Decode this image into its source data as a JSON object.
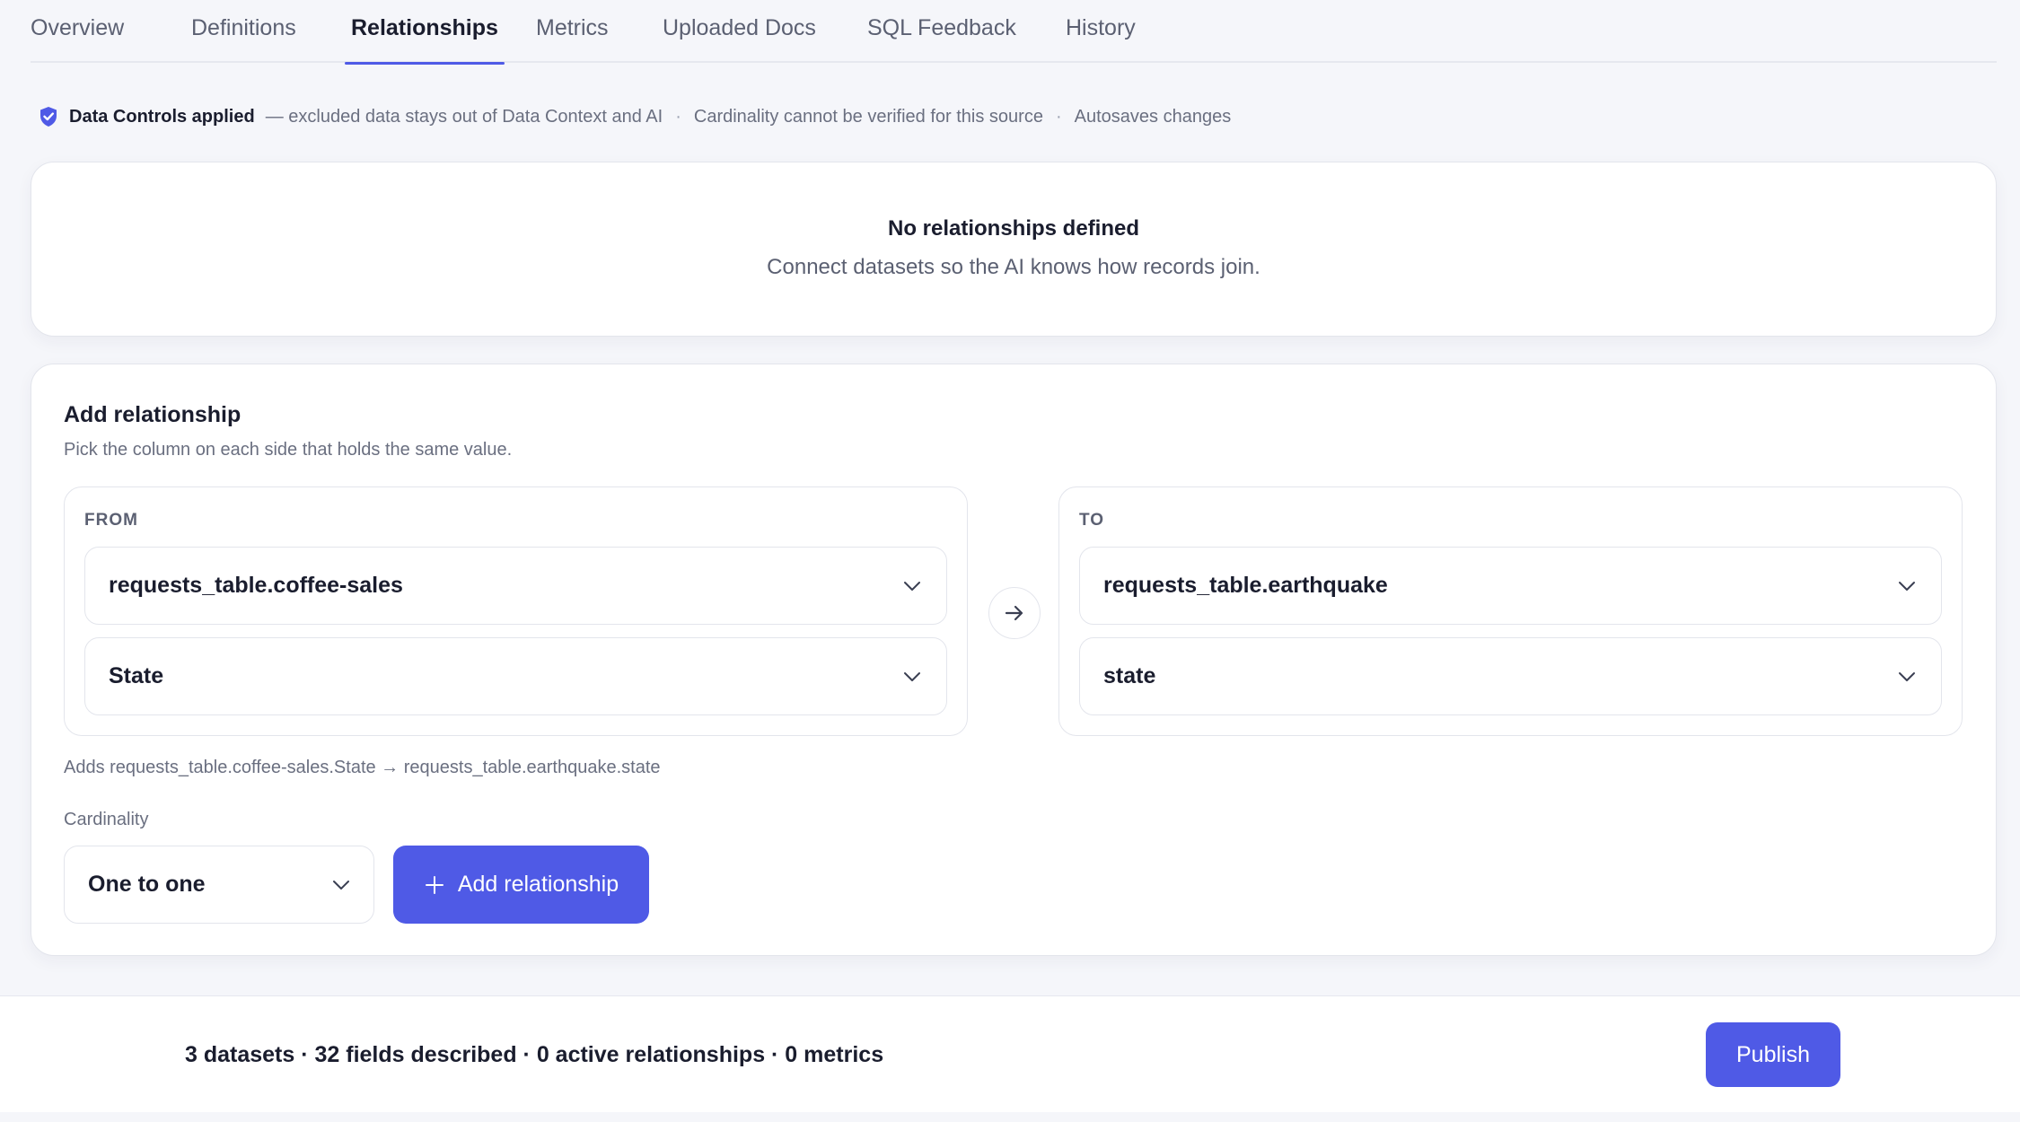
{
  "tabs": [
    {
      "label": "Overview",
      "active": false
    },
    {
      "label": "Definitions",
      "active": false
    },
    {
      "label": "Relationships",
      "active": true
    },
    {
      "label": "Metrics",
      "active": false
    },
    {
      "label": "Uploaded Docs",
      "active": false
    },
    {
      "label": "SQL Feedback",
      "active": false
    },
    {
      "label": "History",
      "active": false
    }
  ],
  "notice": {
    "icon": "shield-check-icon",
    "strong": "Data Controls applied",
    "text": "— excluded data stays out of Data Context and AI",
    "item2": "Cardinality cannot be verified for this source",
    "item3": "Autosaves changes",
    "separator": "·"
  },
  "empty_state": {
    "title": "No relationships defined",
    "subtitle": "Connect datasets so the AI knows how records join."
  },
  "add_relationship": {
    "title": "Add relationship",
    "subtitle": "Pick the column on each side that holds the same value.",
    "from": {
      "label": "FROM",
      "dataset": "requests_table.coffee-sales",
      "column": "State"
    },
    "to": {
      "label": "TO",
      "dataset": "requests_table.earthquake",
      "column": "state"
    },
    "preview": "Adds requests_table.coffee-sales.State → requests_table.earthquake.state",
    "cardinality_label": "Cardinality",
    "cardinality_value": "One to one",
    "add_button": "Add relationship"
  },
  "footer": {
    "stats": "3 datasets · 32 fields described · 0 active relationships · 0 metrics",
    "publish": "Publish"
  },
  "colors": {
    "accent": "#4f5ae6",
    "background": "#f5f6fa",
    "card": "#ffffff",
    "border": "#e3e5ec"
  }
}
